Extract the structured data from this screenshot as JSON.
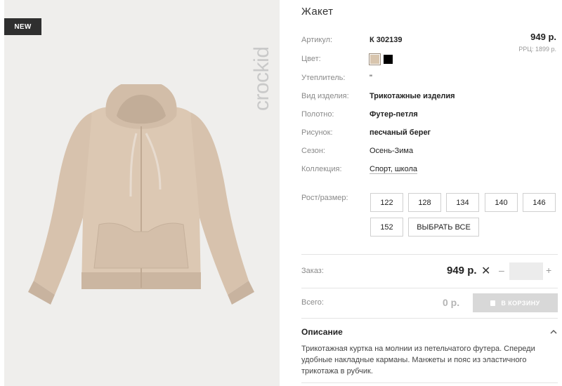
{
  "product": {
    "badge": "NEW",
    "brand": "crockid",
    "title": "Жакет",
    "price_top": "949 р.",
    "rrp": "РРЦ: 1899 р."
  },
  "attributes": [
    {
      "label": "Артикул:",
      "value": "К 302139"
    },
    {
      "label": "Цвет:",
      "value": ""
    },
    {
      "label": "Утеплитель:",
      "value": "\""
    },
    {
      "label": "Вид изделия:",
      "value": "Трикотажные изделия"
    },
    {
      "label": "Полотно:",
      "value": "Футер-петля"
    },
    {
      "label": "Рисунок:",
      "value": "песчаный берег"
    },
    {
      "label": "Сезон:",
      "value": "Осень-Зима"
    },
    {
      "label": "Коллекция:",
      "value": "Спорт, школа"
    }
  ],
  "colors": [
    "#d8c5ae",
    "#000000"
  ],
  "sizes": {
    "label": "Рост/размер:",
    "options": [
      "122",
      "128",
      "134",
      "140",
      "146",
      "152"
    ],
    "select_all": "ВЫБРАТЬ ВСЕ"
  },
  "order": {
    "label": "Заказ:",
    "price": "949 р.",
    "clear_symbol": "✕",
    "minus": "–",
    "plus": "+",
    "quantity": ""
  },
  "total": {
    "label": "Всего:",
    "price": "0 р.",
    "cart_button": "В КОРЗИНУ"
  },
  "description": {
    "title": "Описание",
    "text": "Трикотажная куртка на молнии из петельчатого футера.  Спереди удобные накладные карманы. Манжеты и пояс из эластичного трикотажа в рубчик."
  },
  "icons": {
    "clear": "close-icon",
    "cart": "shopping-bag-icon",
    "collapse": "chevron-up-icon"
  }
}
